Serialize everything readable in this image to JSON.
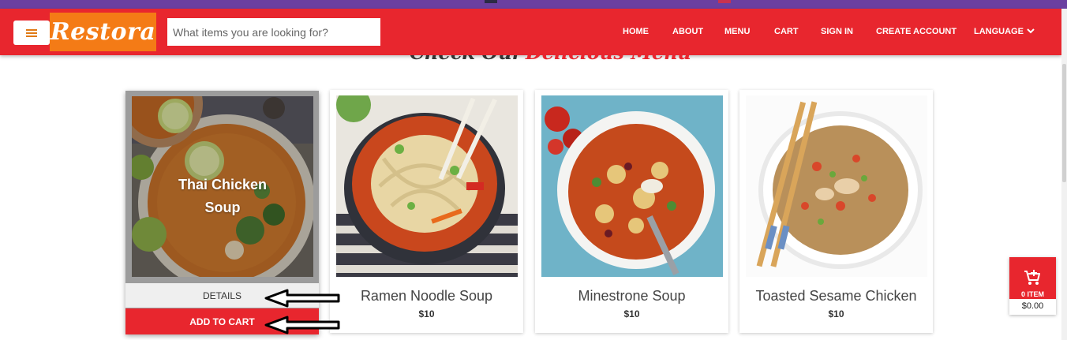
{
  "header": {
    "logo_text": "Restora",
    "search_placeholder": "What items you are looking for?",
    "nav": {
      "home": "HOME",
      "about": "ABOUT",
      "menu": "MENU",
      "cart": "CART",
      "sign_in": "SIGN IN",
      "create_account": "CREATE ACCOUNT",
      "language": "LANGUAGE"
    }
  },
  "section": {
    "heading_part1": "Check Our",
    "heading_part2": "Delicious Menu"
  },
  "cards": [
    {
      "title": "Thai Chicken Soup",
      "title_line1": "Thai Chicken",
      "title_line2": "Soup",
      "details_label": "DETAILS",
      "add_to_cart_label": "ADD TO CART",
      "image": "thai-chicken-soup-image"
    },
    {
      "title": "Ramen Noodle Soup",
      "price": "$10",
      "image": "ramen-noodle-soup-image"
    },
    {
      "title": "Minestrone Soup",
      "price": "$10",
      "image": "minestrone-soup-image"
    },
    {
      "title": "Toasted Sesame Chicken",
      "price": "$10",
      "image": "toasted-sesame-chicken-image"
    }
  ],
  "floating_cart": {
    "icon": "cart-plus-icon",
    "count_label": "0 ITEM",
    "total": "$0.00"
  },
  "colors": {
    "brand_red": "#e8262e",
    "logo_orange": "#f47b16",
    "top_strip_purple": "#6a3fa0"
  }
}
